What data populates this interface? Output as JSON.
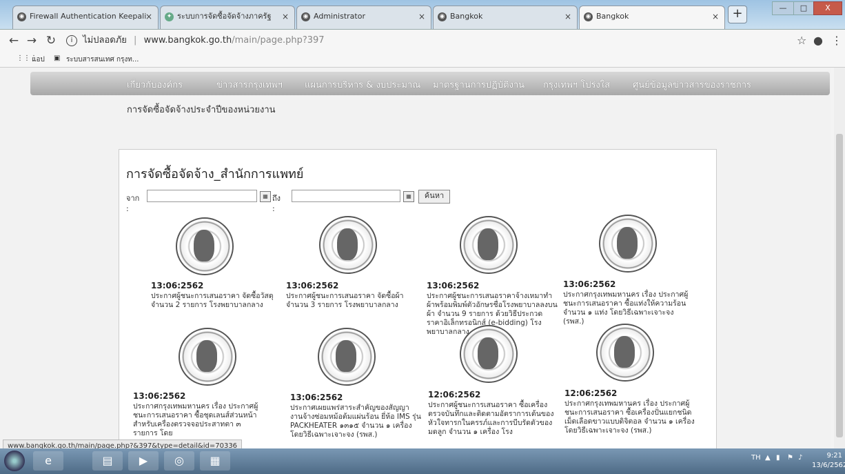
{
  "tabs": [
    {
      "title": "Firewall Authentication Keepali",
      "icon": "globe-icon"
    },
    {
      "title": "ระบบการจัดซื้อจัดจ้างภาครัฐ",
      "icon": "gov-icon"
    },
    {
      "title": "Administrator",
      "icon": "globe-icon"
    },
    {
      "title": "Bangkok",
      "icon": "globe-icon"
    },
    {
      "title": "Bangkok",
      "icon": "globe-icon"
    }
  ],
  "window": {
    "minimize": "—",
    "maximize": "□",
    "close": "X"
  },
  "address": {
    "security": "ไม่ปลอดภัย",
    "domain": "www.bangkok.go.th",
    "path": "/main/page.php?397"
  },
  "bookmarks": {
    "apps": "แอป",
    "item1": "ระบบสารสนเทศ กรุงท..."
  },
  "nav": {
    "items": [
      "เกี่ยวกับองค์กร",
      "ข่าวสารกรุงเทพฯ",
      "แผนการบริหาร & งบประมาณ",
      "มาตรฐานการปฏิบัติงาน",
      "กรุงเทพฯ โปร่งใส",
      "ศูนย์ข้อมูลข่าวสารของราชการ"
    ]
  },
  "breadcrumb": "การจัดซื้อจัดจ้างประจำปีของหน่วยงาน",
  "panel": {
    "title": "การจัดซื้อจัดจ้าง_สำนักการแพทย์",
    "from_label": "จาก :",
    "to_label": "ถึง :",
    "search_button": "ค้นหา"
  },
  "cards": [
    {
      "date": "13:06:2562",
      "text": "ประกาศผู้ชนะการเสนอราคา จัดซื้อวัสดุ จำนวน 2 รายการ โรงพยาบาลกลาง"
    },
    {
      "date": "13:06:2562",
      "text": "ประกาศผู้ชนะการเสนอราคา จัดซื้อผ้า จำนวน 3 รายการ โรงพยาบาลกลาง"
    },
    {
      "date": "13:06:2562",
      "text": "ประกาศผู้ชนะการเสนอราคาจ้างเหมาทำผ้าพร้อมพิมพ์ตัวอักษรชื่อโรงพยาบาลลงบนผ้า จำนวน 9 รายการ ด้วยวิธีประกวดราคาอิเล็กทรอนิกส์ (e-bidding) โรงพยาบาลกลาง"
    },
    {
      "date": "13:06:2562",
      "text": "ประกาศกรุงเทพมหานคร เรื่อง ประกาศผู้ชนะการเสนอราคา ซื้อแท่งให้ความร้อน จำนวน ๑ แท่ง โดยวิธีเฉพาะเจาะจง (รพส.)"
    },
    {
      "date": "13:06:2562",
      "text": "ประกาศกรุงเทพมหานคร เรื่อง ประกาศผู้ชนะการเสนอราคา ซื้อชุดเลนส์ส่วนหน้าสำหรับเครื่องตรวจจอประสาทตา ๓ รายการ โดย"
    },
    {
      "date": "13:06:2562",
      "text": "ประกาศเผยแพร่สาระสำคัญของสัญญางานจ้างซ่อมหม้อต้มแผ่นร้อน ยี่ห้อ IMS รุ่น PACKHEATER ๑๓๑๕ จำนวน ๑ เครื่อง โดยวิธีเฉพาะเจาะจง (รพส.)"
    },
    {
      "date": "12:06:2562",
      "text": "ประกาศผู้ชนะการเสนอราคา ซื้อเครื่องตรวจบันทึกและติดตามอัตราการเต้นของหัวใจทารกในครรภ์และการบีบรัดตัวของมดลูก จำนวน ๑ เครื่อง โรง"
    },
    {
      "date": "12:06:2562",
      "text": "ประกาศกรุงเทพมหานคร เรื่อง ประกาศผู้ชนะการเสนอราคา ซื้อเครื่องปั่นแยกชนิดเม็ดเลือดขาวแบบดิจิตอล จำนวน ๑ เครื่อง โดยวิธีเฉพาะเจาะจง (รพส.)"
    }
  ],
  "status_url": "www.bangkok.go.th/main/page.php?&397&type=detail&id=70336",
  "taskbar": {
    "lang": "TH",
    "time": "9:21",
    "date": "13/6/2562"
  }
}
